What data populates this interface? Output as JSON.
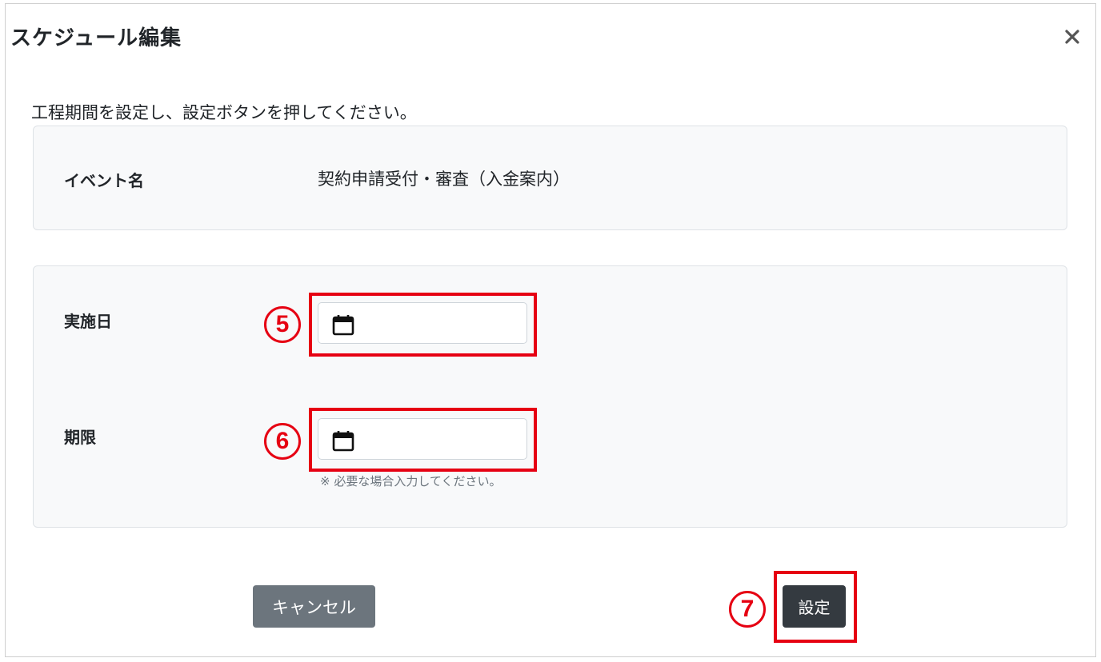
{
  "dialog": {
    "title": "スケジュール編集",
    "close_label": "×"
  },
  "instruction": "工程期間を設定し、設定ボタンを押してください。",
  "event": {
    "label": "イベント名",
    "value": "契約申請受付・審査（入金案内）"
  },
  "dates": {
    "start": {
      "label": "実施日",
      "value": "",
      "step": "5"
    },
    "deadline": {
      "label": "期限",
      "value": "",
      "step": "6",
      "hint": "※ 必要な場合入力してください。"
    }
  },
  "buttons": {
    "cancel_label": "キャンセル",
    "submit_label": "設定",
    "submit_step": "7"
  },
  "colors": {
    "highlight": "#e60012",
    "cancel_bg": "#6c757d",
    "submit_bg": "#343a40",
    "card_bg": "#f8f9fa"
  }
}
